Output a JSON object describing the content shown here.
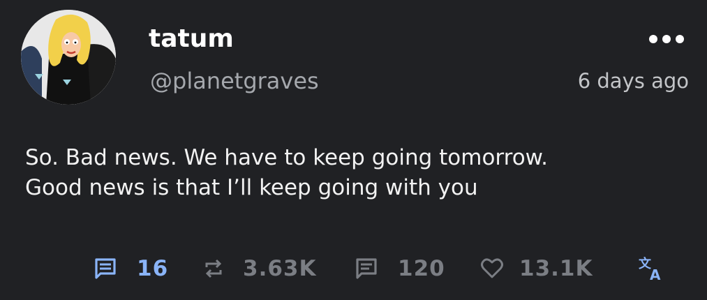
{
  "post": {
    "author": {
      "display_name": "tatum",
      "handle": "@planetgraves",
      "avatar_icon": "profile-avatar-cartoon-woman"
    },
    "timestamp": "6 days ago",
    "more_icon": "more-dots-icon",
    "text_lines": [
      "So. Bad news. We have to keep going tomorrow.",
      "Good news is that I’ll keep going with you"
    ]
  },
  "actions": {
    "comments": {
      "icon": "comment-icon",
      "count": "16",
      "color": "#8ab4f8"
    },
    "reblogs": {
      "icon": "repost-icon",
      "count": "3.63K",
      "color": "#7b7e84"
    },
    "quotes": {
      "icon": "quote-icon",
      "count": "120",
      "color": "#7b7e84"
    },
    "likes": {
      "icon": "heart-icon",
      "count": "13.1K",
      "color": "#7b7e84"
    },
    "translate": {
      "icon": "translate-icon",
      "color": "#8ab4f8"
    }
  }
}
